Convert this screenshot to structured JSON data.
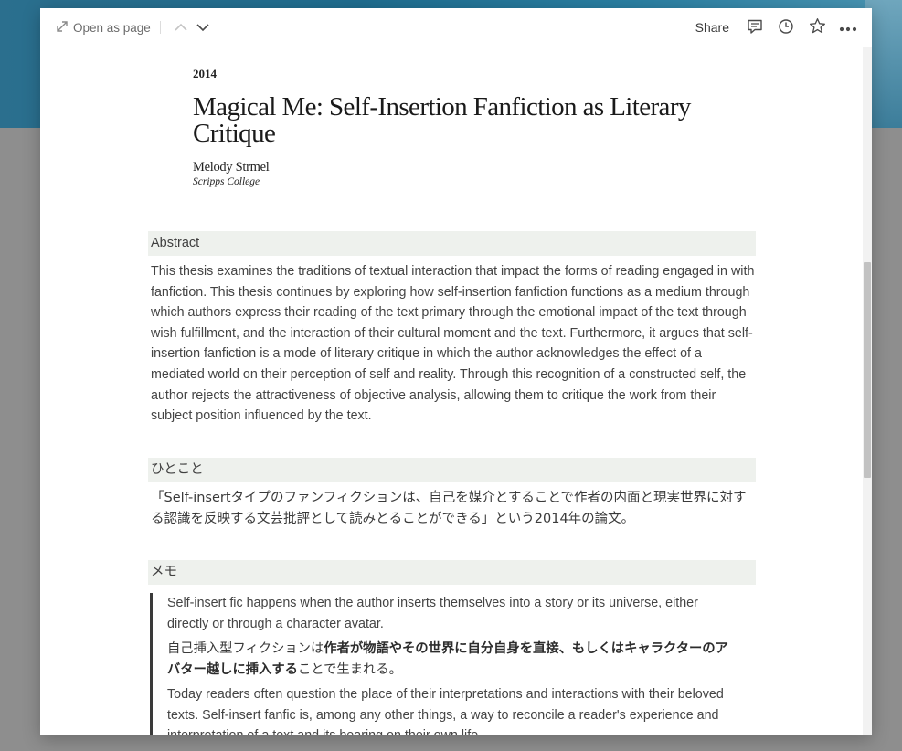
{
  "topbar": {
    "open_as_page": "Open as page",
    "share": "Share",
    "icons": [
      "expand-icon",
      "chevron-up-icon",
      "chevron-down-icon",
      "comment-icon",
      "history-icon",
      "star-icon",
      "more-icon"
    ]
  },
  "paper": {
    "year": "2014",
    "title": "Magical Me: Self-Insertion Fanfiction as Literary Critique",
    "author": "Melody Strmel",
    "affiliation": "Scripps College"
  },
  "sections": {
    "abstract": {
      "heading": "Abstract",
      "body": "This thesis examines the traditions of textual interaction that impact the forms of reading engaged in with fanfiction. This thesis continues by exploring how self-insertion fanfiction functions as a medium through which authors express their reading of the text primary through the emotional impact of the text through wish fulfillment, and the interaction of their cultural moment and the text. Furthermore, it argues that self-insertion fanfiction is a mode of literary critique in which the author acknowledges the effect of a mediated world on their perception of self and reality. Through this recognition of a constructed self, the author rejects the attractiveness of objective analysis, allowing them to critique the work from their subject position influenced by the text."
    },
    "hitokoto": {
      "heading": "ひとこと",
      "body": "「Self-insertタイプのファンフィクションは、自己を媒介とすることで作者の内面と現実世界に対する認識を反映する文芸批評として読みとることができる」という2014年の論文。"
    },
    "memo": {
      "heading": "メモ",
      "quote_en_1": "Self-insert fic happens when the author inserts themselves into a story or its universe, either directly or through a character avatar.",
      "quote_jp_pre": "自己挿入型フィクションは",
      "quote_jp_bold": "作者が物語やその世界に自分自身を直接、もしくはキャラクターのアバター越しに挿入する",
      "quote_jp_post": "ことで生まれる。",
      "quote_en_2": "Today readers often question the place of their interpretations and interactions with their beloved texts. Self-insert fanfic is, among any other things, a way to reconcile a reader's experience and interpretation of a text and its bearing on their own life."
    }
  }
}
